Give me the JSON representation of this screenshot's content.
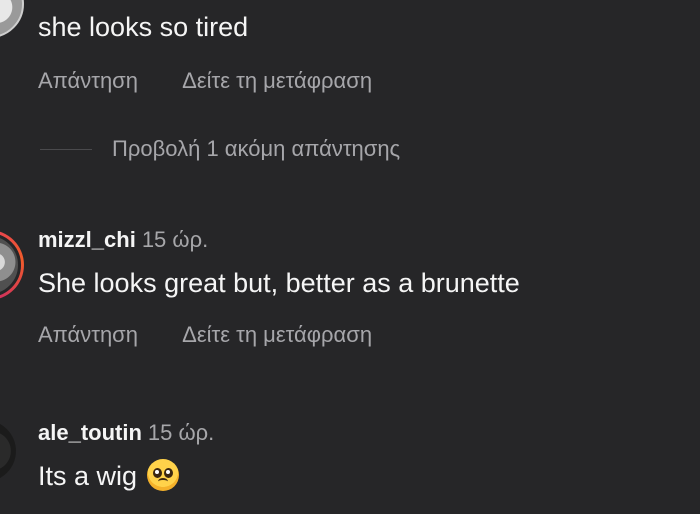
{
  "comments": [
    {
      "username": "",
      "time": "",
      "text": "she looks so tired",
      "reply_label": "Απάντηση",
      "translate_label": "Δείτε τη μετάφραση"
    },
    {
      "username": "mizzl_chi",
      "time": "15 ώρ.",
      "text": "She looks great but, better as a brunette",
      "reply_label": "Απάντηση",
      "translate_label": "Δείτε τη μετάφραση"
    },
    {
      "username": "ale_toutin",
      "time": "15 ώρ.",
      "text": "Its a wig",
      "emoji": "pleading-face-emoji"
    }
  ],
  "view_more_replies_label": "Προβολή 1 ακόμη απάντησης",
  "colors": {
    "background": "#262628",
    "primary_text": "#f5f5f5",
    "secondary_text": "#a6a6aa",
    "story_ring": "#e1306c"
  }
}
